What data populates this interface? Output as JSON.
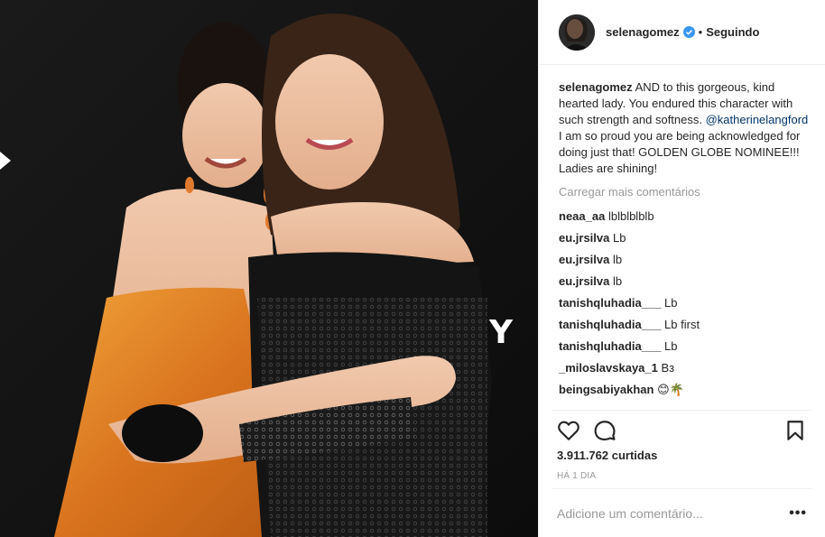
{
  "post": {
    "author": "selenagomez",
    "follow_status": "Seguindo",
    "separator": "•",
    "caption": {
      "user": "selenagomez",
      "text_before_mention": "AND to this gorgeous, kind hearted lady. You endured this character with such strength and softness.",
      "mention": "@katherinelangford",
      "text_after_mention": "I am so proud you are being acknowledged for doing just that! GOLDEN GLOBE NOMINEE!!! Ladies are shining!"
    },
    "load_more": "Carregar mais comentários",
    "comments": [
      {
        "user": "neaa_aa",
        "text": "lblblblblb"
      },
      {
        "user": "eu.jrsilva",
        "text": "Lb"
      },
      {
        "user": "eu.jrsilva",
        "text": "lb"
      },
      {
        "user": "eu.jrsilva",
        "text": "lb"
      },
      {
        "user": "tanishqluhadia___",
        "text": "Lb"
      },
      {
        "user": "tanishqluhadia___",
        "text": "Lb first"
      },
      {
        "user": "tanishqluhadia___",
        "text": "Lb"
      },
      {
        "user": "_miloslavskaya_1",
        "text": "Вз"
      },
      {
        "user": "beingsabiyakhan",
        "text": "😊🌴"
      }
    ],
    "likes": "3.911.762 curtidas",
    "time_ago": "HÁ 1 DIA",
    "add_comment_placeholder": "Adicione um comentário...",
    "more_options": "•••",
    "photo_backdrop_letters": [
      "Y"
    ],
    "icons": {
      "like": "heart-icon",
      "comment": "comment-bubble-icon",
      "save": "bookmark-icon",
      "verified": "verified-badge-icon"
    },
    "colors": {
      "link": "#003569",
      "muted": "#999999",
      "verified": "#3897f0",
      "border": "#efefef"
    }
  }
}
